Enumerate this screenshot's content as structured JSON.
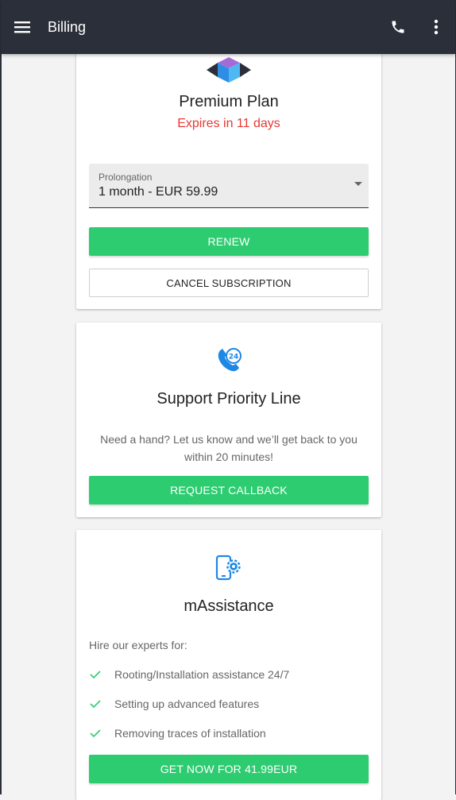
{
  "appbar": {
    "title": "Billing",
    "menu_icon": "hamburger-menu-icon",
    "phone_icon": "phone-icon",
    "more_icon": "more-vert-icon"
  },
  "plan_card": {
    "logo_icon": "premium-plan-cube-icon",
    "title": "Premium Plan",
    "expiry": "Expires in 11 days",
    "prolongation": {
      "label": "Prolongation",
      "value": "1 month - EUR 59.99"
    },
    "renew_label": "RENEW",
    "cancel_label": "CANCEL SUBSCRIPTION"
  },
  "support_card": {
    "icon": "support-24-phone-icon",
    "title": "Support Priority Line",
    "description": "Need a hand? Let us know and we’ll get back to you within 20 minutes!",
    "button_label": "REQUEST CALLBACK"
  },
  "assist_card": {
    "icon": "mobile-settings-icon",
    "title": "mAssistance",
    "intro": "Hire our experts for:",
    "items": [
      "Rooting/Installation assistance 24/7",
      "Setting up advanced features",
      "Removing traces of installation"
    ],
    "button_label": "GET NOW FOR 41.99EUR"
  },
  "colors": {
    "appbar": "#2b2f3a",
    "accent_green": "#2ecc71",
    "expiry_red": "#e53935",
    "icon_blue": "#1e88e5"
  }
}
